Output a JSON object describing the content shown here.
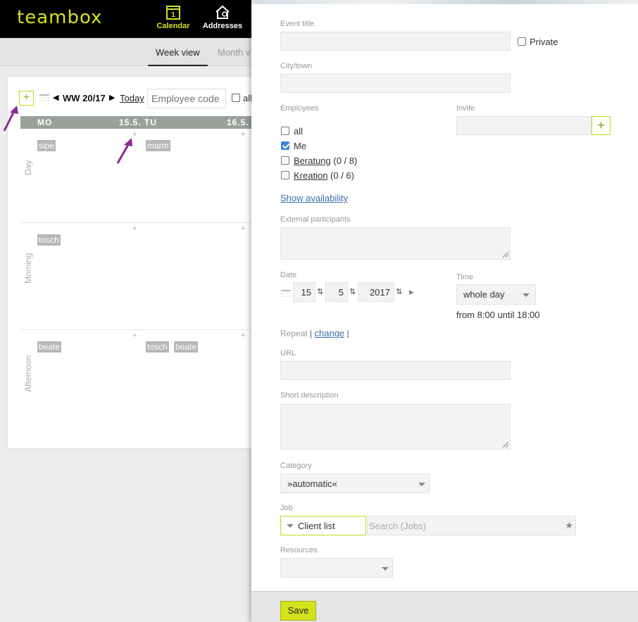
{
  "app": {
    "logo": "teambox"
  },
  "nav": {
    "calendar": {
      "label": "Calendar",
      "day": "1"
    },
    "addresses": {
      "label": "Addresses"
    }
  },
  "subnav": {
    "week_view": "Week view",
    "month_view": "Month v"
  },
  "calendar": {
    "week_label": "WW 20/17",
    "today": "Today",
    "employee_placeholder": "Employee code",
    "all_label": "all",
    "days": [
      {
        "name": "MO",
        "date": "15.5."
      },
      {
        "name": "TU",
        "date": "16.5."
      }
    ],
    "rows": [
      {
        "label": "Day",
        "mo": [
          "sipe"
        ],
        "tu": [
          "marm"
        ]
      },
      {
        "label": "Morning",
        "mo": [
          "tosch"
        ],
        "tu": []
      },
      {
        "label": "Afternoon",
        "mo": [
          "beate"
        ],
        "tu": [
          "tosch",
          "beate"
        ]
      }
    ],
    "plus": "+"
  },
  "form": {
    "event_title_label": "Event title",
    "event_title_value": "",
    "private_label": "Private",
    "city_label": "City/town",
    "employees_label": "Employees",
    "invite_label": "Invite",
    "employees": [
      {
        "label": "all",
        "checked": false,
        "link": false
      },
      {
        "label": "Me",
        "checked": true,
        "link": false
      },
      {
        "label": "Beratung",
        "count": " (0 / 8)",
        "checked": false,
        "link": true
      },
      {
        "label": "Kreation",
        "count": " (0 / 6)",
        "checked": false,
        "link": true
      }
    ],
    "show_availability": "Show availability",
    "external_label": "External participants",
    "date_label": "Date",
    "date_day": "15",
    "date_month": "5",
    "date_year": "2017",
    "time_label": "Time",
    "time_value": "whole day",
    "time_range": "from 8:00 until 18:00",
    "repeat_label": "Repeat",
    "repeat_sep": "|",
    "repeat_change": "change",
    "url_label": "URL",
    "short_desc_label": "Short description",
    "category_label": "Category",
    "category_value": "»automatic«",
    "job_label": "Job",
    "job_client_list": "Client list",
    "job_search_placeholder": "Search (Jobs)",
    "resources_label": "Resources",
    "save": "Save"
  },
  "colors": {
    "accent": "#d4e21b",
    "chip": "#b7b7b7",
    "dayhead": "#9aa19b",
    "annotation": "#8e2a97"
  }
}
